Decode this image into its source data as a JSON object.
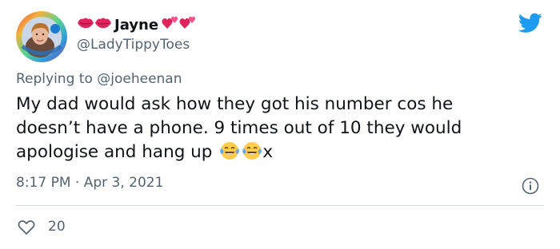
{
  "author": {
    "display_name": "Jayne",
    "handle": "@LadyTippyToes",
    "name_prefix_emojis": [
      "kiss-lips-icon",
      "kiss-lips-icon"
    ],
    "name_suffix_emojis": [
      "two-hearts-icon",
      "two-hearts-icon"
    ]
  },
  "reply": {
    "prefix": "Replying to",
    "mention": "@joeheenan"
  },
  "tweet": {
    "lines": [
      "My dad would ask how they got his number cos he",
      "doesn’t have a phone. 9 times out of 10 they would",
      "apologise and hang up"
    ],
    "trailing_emojis": [
      "tears-of-joy-icon",
      "tears-of-joy-icon"
    ],
    "trailing_text": "x"
  },
  "meta": {
    "time": "8:17 PM",
    "separator": "·",
    "date": "Apr 3, 2021"
  },
  "actions": {
    "likes": "20"
  },
  "colors": {
    "text": "#0f1419",
    "secondary": "#536471",
    "twitter_blue": "#1d9bf0",
    "divider": "#cfd9de"
  }
}
